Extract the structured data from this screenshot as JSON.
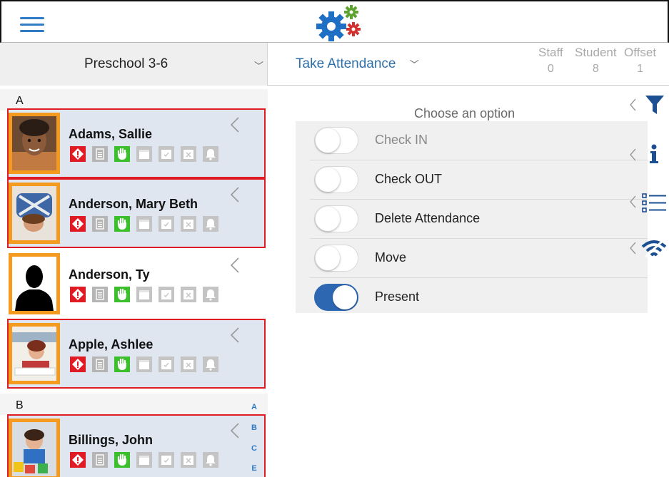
{
  "header": {
    "menu_icon": "hamburger-menu-icon",
    "logo_icon": "gears-logo-icon"
  },
  "class_selector": {
    "selected": "Preschool 3-6",
    "chevron_icon": "chevron-down-icon"
  },
  "action_selector": {
    "selected": "Take Attendance",
    "chevron_icon": "chevron-down-icon"
  },
  "stats": [
    {
      "label": "Staff",
      "value": "0"
    },
    {
      "label": "Student",
      "value": "8"
    },
    {
      "label": "Offset",
      "value": "1"
    }
  ],
  "sections": [
    {
      "letter": "A",
      "students": [
        {
          "name": "Adams, Sallie",
          "highlighted": true
        },
        {
          "name": "Anderson, Mary Beth",
          "highlighted": true
        },
        {
          "name": "Anderson, Ty",
          "highlighted": false
        },
        {
          "name": "Apple, Ashlee",
          "highlighted": true
        }
      ]
    },
    {
      "letter": "B",
      "students": [
        {
          "name": "Billings, John",
          "highlighted": true
        }
      ]
    }
  ],
  "row_icons": [
    "allergy-alert-icon",
    "document-icon",
    "hand-icon",
    "calendar-icon",
    "calendar-check-icon",
    "calendar-x-icon",
    "bell-icon"
  ],
  "alphabet_index": [
    "A",
    "B",
    "C",
    "E"
  ],
  "options_panel": {
    "title": "Choose an option",
    "options": [
      {
        "label": "Check IN",
        "on": false,
        "dim": true
      },
      {
        "label": "Check OUT",
        "on": false,
        "dim": false
      },
      {
        "label": "Delete Attendance",
        "on": false,
        "dim": false
      },
      {
        "label": "Move",
        "on": false,
        "dim": false
      },
      {
        "label": "Present",
        "on": true,
        "dim": false
      }
    ]
  },
  "side_tools": [
    "filter-icon",
    "info-icon",
    "list-icon",
    "wifi-icon"
  ],
  "colors": {
    "accent_blue": "#2f7bc6",
    "toggle_on": "#2d67b1",
    "row_border_red": "#e01b24",
    "avatar_orange": "#f39a1f",
    "alert_red": "#e01b24",
    "hand_green": "#3bbf2a",
    "gear_blue": "#1f6fc4",
    "gear_green": "#5ea330",
    "gear_red": "#d4302f"
  }
}
